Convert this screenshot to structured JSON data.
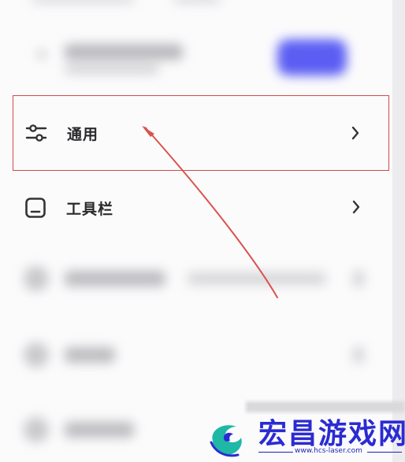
{
  "settings": {
    "items": [
      {
        "label": "通用",
        "icon": "sliders-icon",
        "highlighted": true
      },
      {
        "label": "工具栏",
        "icon": "toolbar-icon",
        "highlighted": false
      }
    ]
  },
  "watermark": {
    "title": "宏昌游戏网",
    "url": "www.hcs-laser.com",
    "logo": "swirl-logo"
  },
  "colors": {
    "highlight_border": "#d24a4a",
    "accent_button": "#5b5ef3",
    "watermark_blue": "#2b2bd2"
  }
}
